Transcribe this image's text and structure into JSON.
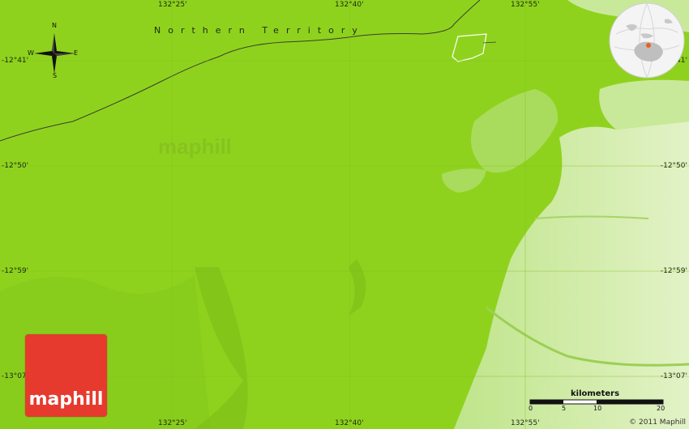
{
  "map": {
    "region_label": "Northern Territory",
    "watermark": "maphill",
    "lon_top": [
      "132°25'",
      "132°40'",
      "132°55'"
    ],
    "lon_bottom": [
      "132°25'",
      "132°40'",
      "132°55'"
    ],
    "lat_left": [
      "-12°41'",
      "-12°50'",
      "-12°59'",
      "-13°07'"
    ],
    "lat_right": [
      "-12°41'",
      "-12°50'",
      "-12°59'",
      "-13°07'"
    ],
    "colors": {
      "lowland": "#8fd21e",
      "highland": "#d8edb0",
      "boundary": "#3a3f2a"
    }
  },
  "compass": {
    "n": "N",
    "s": "S",
    "e": "E",
    "w": "W"
  },
  "logo": {
    "text": "maphill"
  },
  "scale": {
    "title": "kilometers",
    "ticks": [
      "0",
      "5",
      "10",
      "20"
    ]
  },
  "copyright": "© 2011 Maphill"
}
